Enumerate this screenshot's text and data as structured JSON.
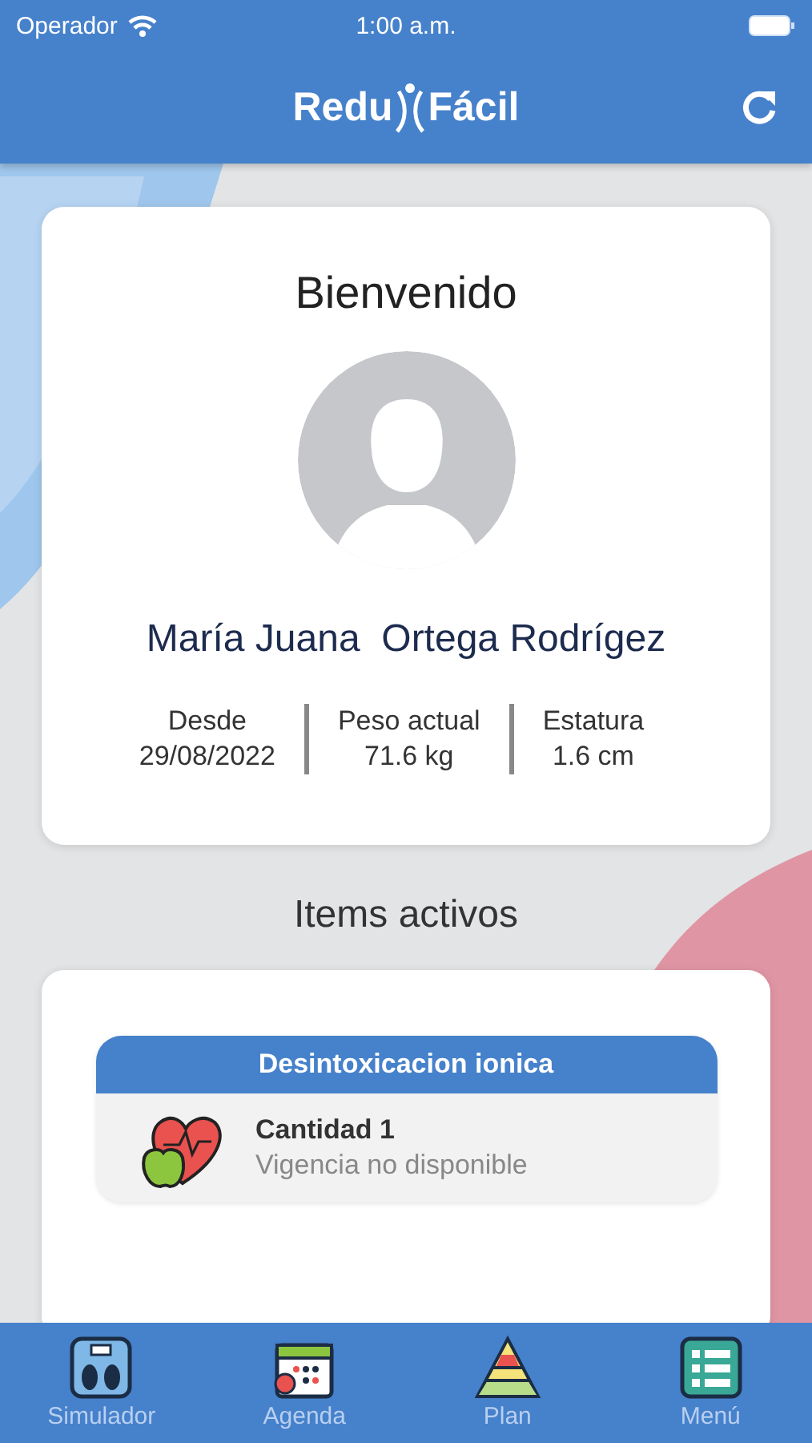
{
  "status_bar": {
    "carrier": "Operador",
    "time": "1:00 a.m."
  },
  "header": {
    "logo_left": "Redu",
    "logo_right": "Fácil"
  },
  "profile": {
    "greeting": "Bienvenido",
    "name": "María Juana  Ortega Rodrígez",
    "stats": [
      {
        "label": "Desde",
        "value": "29/08/2022"
      },
      {
        "label": "Peso actual",
        "value": "71.6 kg"
      },
      {
        "label": "Estatura",
        "value": "1.6 cm"
      }
    ]
  },
  "items_title": "Items activos",
  "items": [
    {
      "title": "Desintoxicacion ionica",
      "quantity": "Cantidad 1",
      "validity": "Vigencia no disponible"
    }
  ],
  "tabs": [
    {
      "label": "Simulador",
      "kind": "scale",
      "selected": false
    },
    {
      "label": "Agenda",
      "kind": "calendar",
      "selected": false
    },
    {
      "label": "Plan",
      "kind": "pyramid",
      "selected": false
    },
    {
      "label": "Menú",
      "kind": "list",
      "selected": false
    }
  ]
}
